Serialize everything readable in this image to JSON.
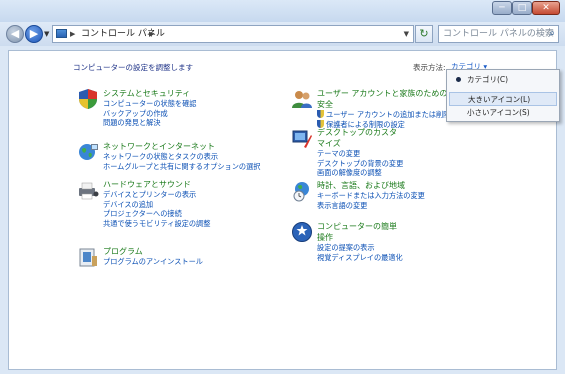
{
  "window": {
    "controls": {
      "minimize": "─",
      "maximize": "□",
      "close": "✕"
    }
  },
  "nav": {
    "breadcrumb": "コントロール パネル",
    "search_placeholder": "コントロール パネルの検索"
  },
  "main": {
    "heading": "コンピューターの設定を調整します",
    "view_label": "表示方法:",
    "view_value": "カテゴリ ▾"
  },
  "view_menu": {
    "items": [
      {
        "label": "カテゴリ(C)",
        "selected": true
      },
      {
        "label": "大きいアイコン(L)",
        "selected": false
      },
      {
        "label": "小さいアイコン(S)",
        "selected": false
      }
    ]
  },
  "categories": [
    {
      "icon": "shield-icon",
      "title": "システムとセキュリティ",
      "links": [
        "コンピューターの状態を確認",
        "バックアップの作成",
        "問題の発見と解決"
      ]
    },
    {
      "icon": "globe-network-icon",
      "title": "ネットワークとインターネット",
      "links": [
        "ネットワークの状態とタスクの表示",
        "ホームグループと共有に関するオプションの選択"
      ]
    },
    {
      "icon": "printer-icon",
      "title": "ハードウェアとサウンド",
      "links": [
        "デバイスとプリンターの表示",
        "デバイスの追加",
        "プロジェクターへの接続",
        "共通で使うモビリティ設定の調整"
      ]
    },
    {
      "icon": "programs-icon",
      "title": "プログラム",
      "links": [
        "プログラムのアンインストール"
      ]
    },
    {
      "icon": "users-icon",
      "title": "ユーザー アカウントと家族のための安全",
      "links": [
        "ユーザー アカウントの追加または削除",
        "保護者による制限の設定"
      ]
    },
    {
      "icon": "appearance-icon",
      "title": "デスクトップのカスタマイズ",
      "links": [
        "テーマの変更",
        "デスクトップの背景の変更",
        "画面の解像度の調整"
      ]
    },
    {
      "icon": "clock-globe-icon",
      "title": "時計、言語、および地域",
      "links": [
        "キーボードまたは入力方法の変更",
        "表示言語の変更"
      ]
    },
    {
      "icon": "ease-of-access-icon",
      "title": "コンピューターの簡単操作",
      "links": [
        "設定の提案の表示",
        "視覚ディスプレイの最適化"
      ]
    }
  ]
}
